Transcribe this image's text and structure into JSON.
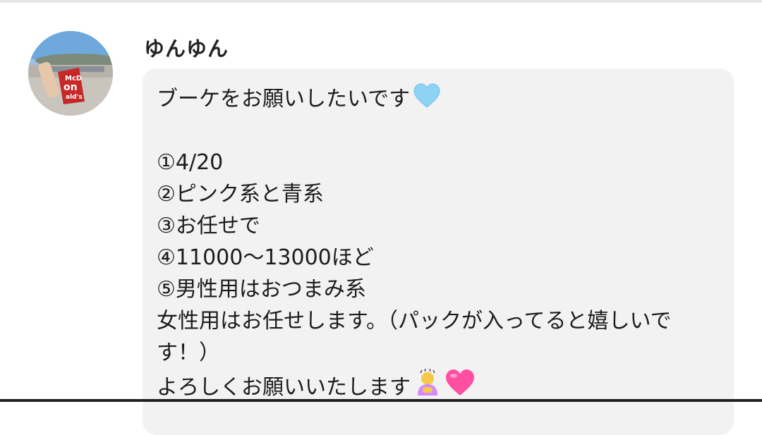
{
  "post": {
    "username": "ゆんゆん",
    "lines": [
      "ブーケをお願いしたいです",
      "",
      "①4/20",
      "②ピンク系と青系",
      "③お任せで",
      "④11000～13000ほど",
      "⑤男性用はおつまみ系",
      "女性用はお任せします。（パックが入ってると嬉しいです！）",
      "よろしくお願いいたします"
    ],
    "emojis": {
      "line1": "blue-heart-icon",
      "line9_a": "person-bowing-icon",
      "line9_b": "pink-heart-icon"
    }
  },
  "colors": {
    "bubble": "#f2f2f2",
    "username": "#222222",
    "text": "#1c1c1c",
    "blue_heart": "#8fd3f4",
    "pink_heart": "#ff4fa3"
  }
}
